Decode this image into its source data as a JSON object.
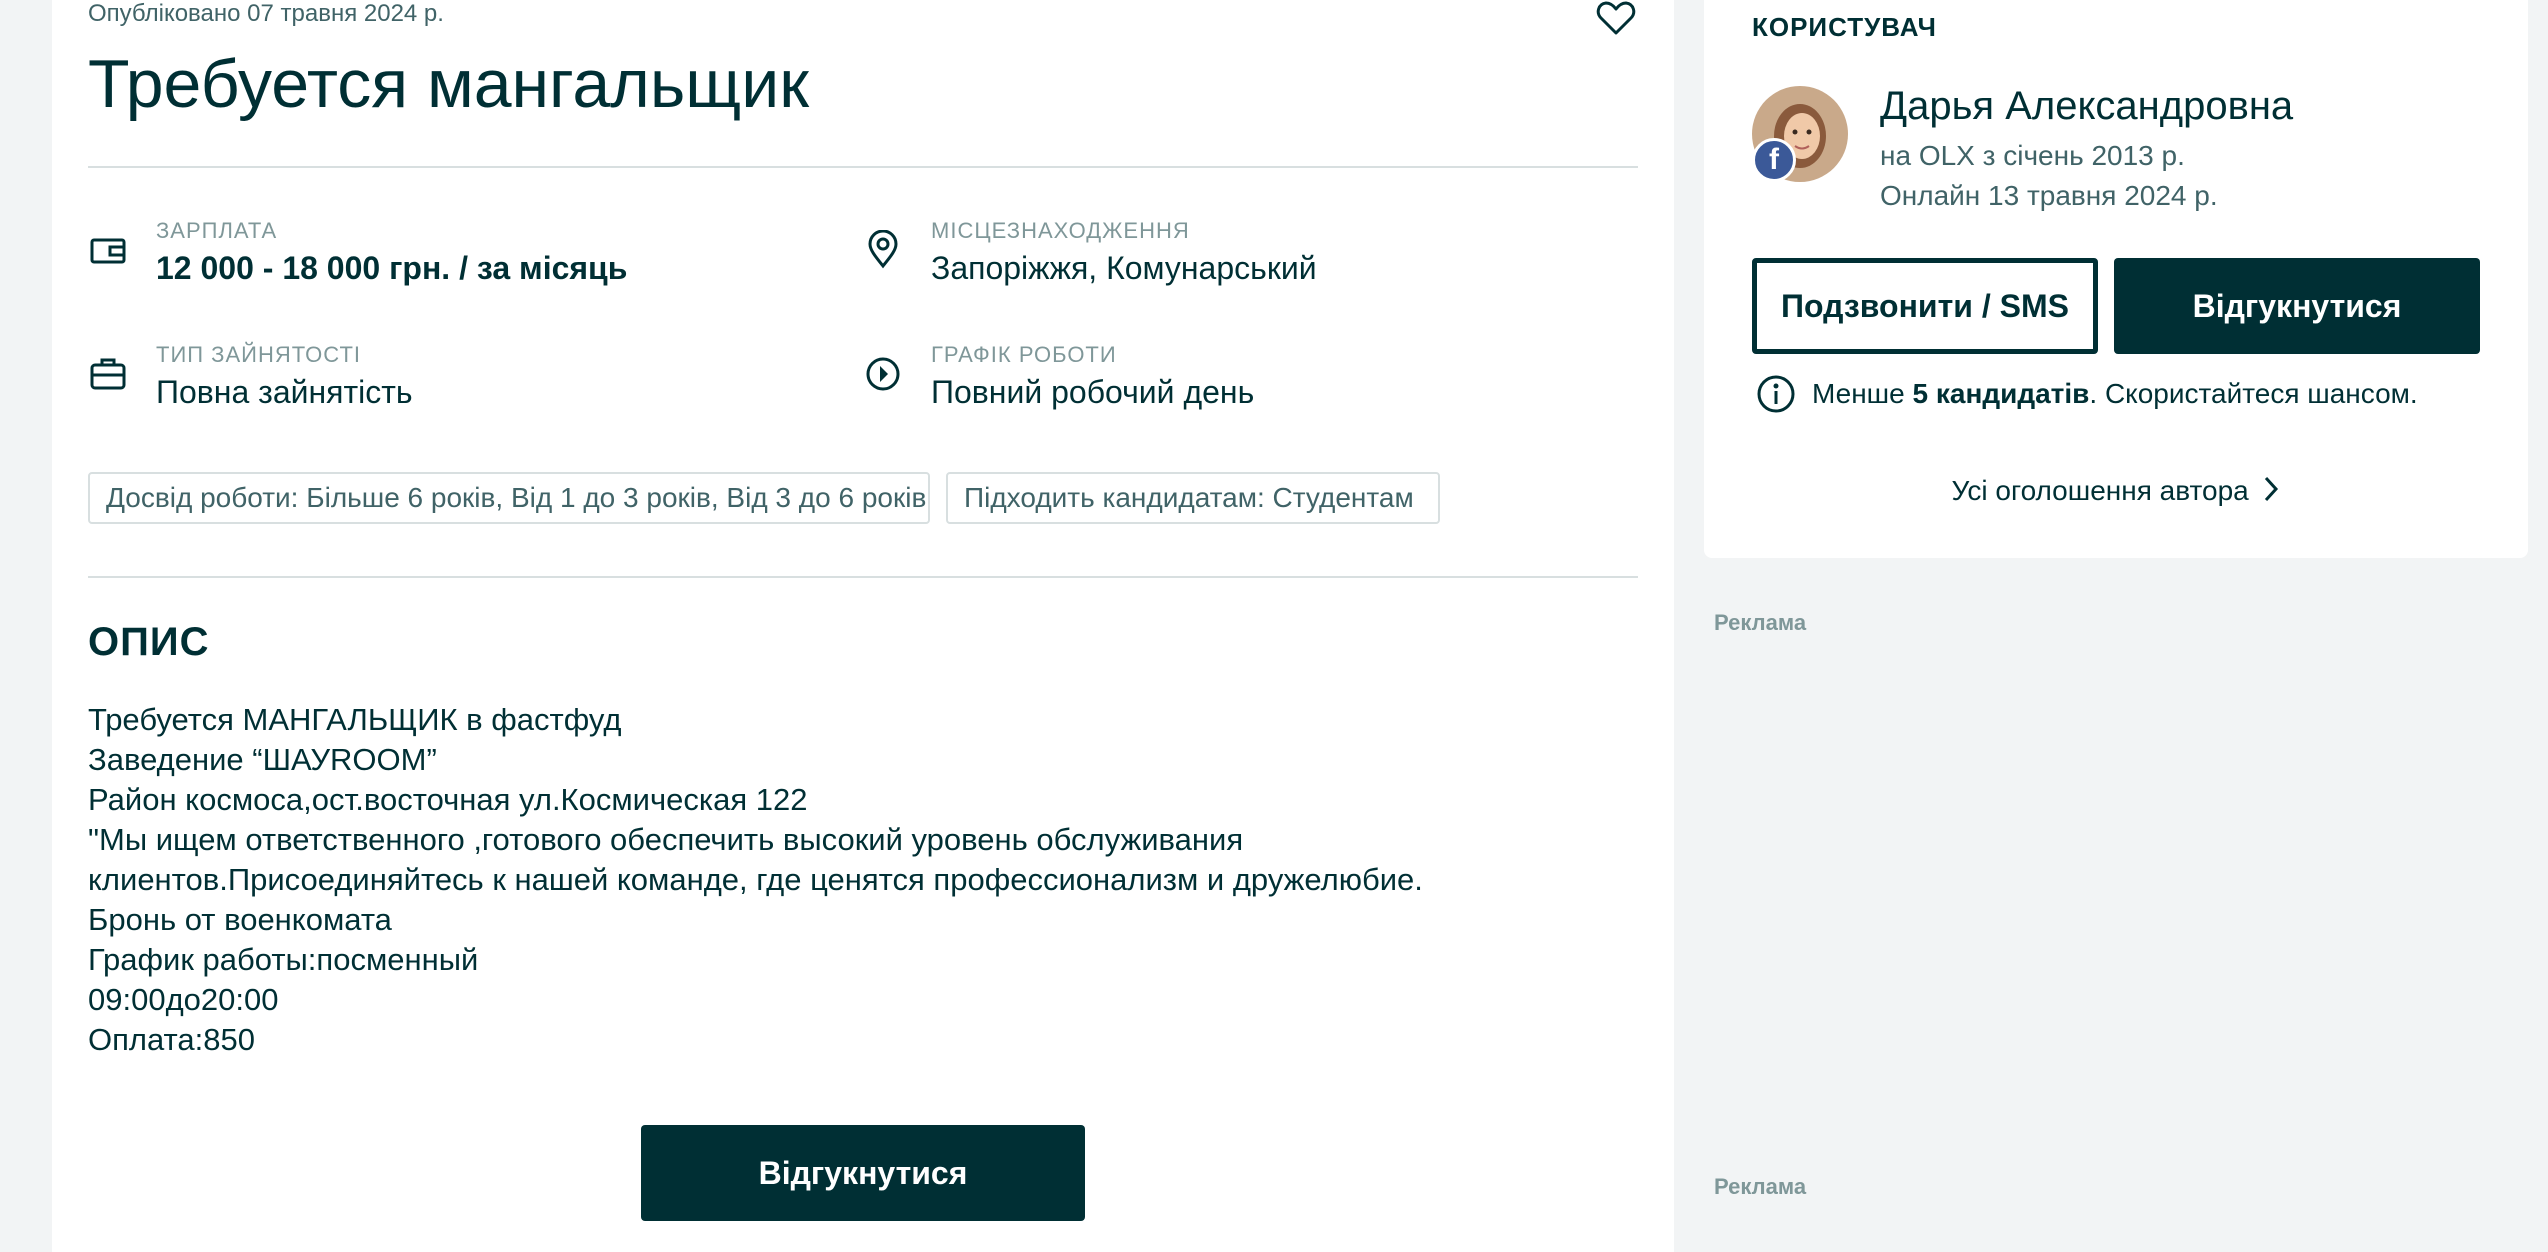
{
  "listing": {
    "published": "Опубліковано 07 травня 2024 р.",
    "title": "Требуется мангальщик",
    "fields": {
      "salary": {
        "label": "ЗАРПЛАТА",
        "value": "12 000 - 18 000 грн. / за місяць"
      },
      "location": {
        "label": "МІСЦЕЗНАХОДЖЕННЯ",
        "value": "Запоріжжя, Комунарський"
      },
      "employment": {
        "label": "ТИП ЗАЙНЯТОСТІ",
        "value": "Повна зайнятість"
      },
      "schedule": {
        "label": "ГРАФІК РОБОТИ",
        "value": "Повний робочий день"
      }
    },
    "tags": [
      "Досвід роботи: Більше 6 років, Від 1 до 3 років, Від 3 до 6 років",
      "Підходить кандидатам: Студентам"
    ],
    "description_title": "ОПИС",
    "description_lines": [
      "Требуется МАНГАЛЬЩИК в фастфуд",
      "Заведение “ШАУROOM”",
      "Район космоса,ост.восточная ул.Космическая 122",
      "\"Мы ищем ответственного ,готового обеспечить высокий уровень обслуживания",
      "клиентов.Присоединяйтесь к нашей команде, где ценятся профессионализм и дружелюбие.",
      "Бронь от военкомата",
      "График работы:посменный",
      "09:00до20:00",
      "Оплата:850"
    ],
    "apply_label": "Відгукнутися"
  },
  "user": {
    "section_label": "КОРИСТУВАЧ",
    "name": "Дарья Александровна",
    "member_since": "на OLX з січень 2013 р.",
    "online": "Онлайн 13 травня 2024 р.",
    "call_label": "Подзвонити / SMS",
    "apply_label": "Відгукнутися",
    "hint_prefix": "Менше ",
    "hint_bold": "5 кандидатів",
    "hint_suffix": ". Скористайтеся шансом.",
    "all_ads_label": "Усі оголошення автора",
    "facebook_letter": "f"
  },
  "ads": {
    "label_1": "Реклама",
    "label_2": "Реклама"
  },
  "icons": {
    "favorite": "heart-icon",
    "salary": "wallet-icon",
    "location": "map-pin-icon",
    "employment": "briefcase-icon",
    "schedule": "clock-icon",
    "hint": "info-icon",
    "all_ads": "chevron-right-icon"
  },
  "colors": {
    "primary": "#002f34",
    "muted": "#406367",
    "label": "#7f9799",
    "border": "#d8dfe0",
    "background": "#f2f4f5",
    "facebook": "#3b5998"
  }
}
